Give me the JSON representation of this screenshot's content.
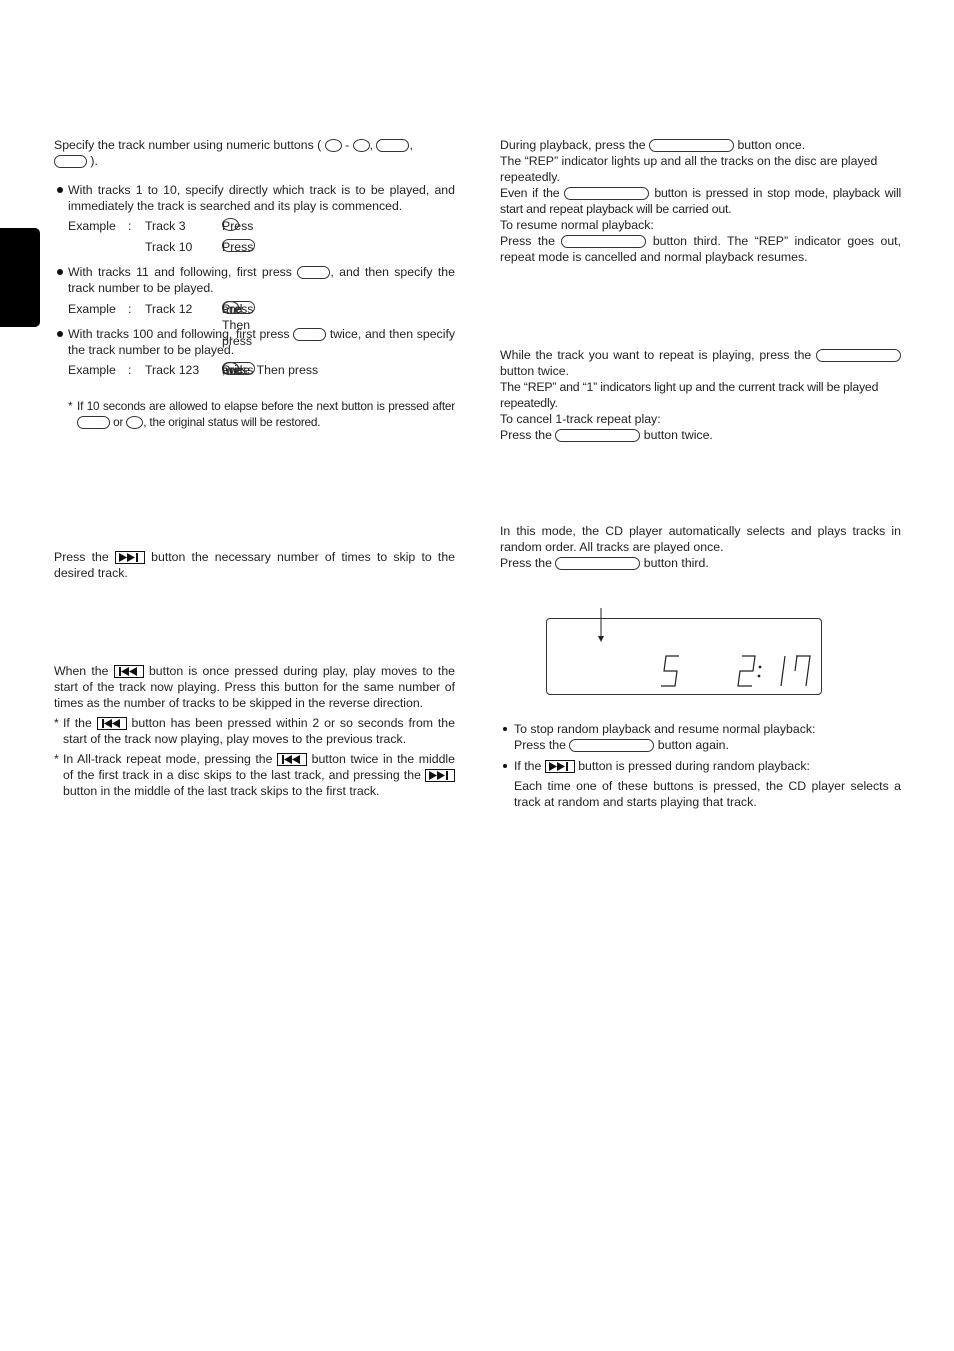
{
  "left": {
    "direct_select": {
      "intro_a": "Specify the track number using numeric buttons (",
      "intro_dash": "-",
      "intro_comma": ",",
      "intro_comma2": ",",
      "intro_end": ").",
      "bullets": [
        {
          "text": "With tracks 1 to 10, specify directly which track is to be played, and immediately the track is searched and its play is commenced.",
          "examples": [
            {
              "label": "Example",
              "colon": ":",
              "track": "Track 3",
              "press": "Press",
              "end": "."
            },
            {
              "track": "Track 10",
              "press": "Press",
              "end": "."
            }
          ]
        },
        {
          "text_a": "With tracks 11 and following, first press",
          "text_b": ", and then specify the track number to be played.",
          "example": {
            "label": "Example",
            "colon": ":",
            "track": "Track 12",
            "press": "Press",
            "then": ". Then press",
            "and": "and",
            "end": "."
          }
        },
        {
          "text_a": "With tracks 100 and following, first press",
          "text_b": "twice, and then specify the track number to be played.",
          "example": {
            "label": "Example",
            "colon": ":",
            "track": "Track 123",
            "press": "Press",
            "then": "twice.  Then press",
            "comma": ",",
            "and": "and",
            "end": "."
          }
        }
      ],
      "note": {
        "asterisk": "*",
        "text_a": "If 10 seconds are allowed to elapse before the next button is pressed after",
        "or": "or",
        "text_b": ", the original status will be restored."
      }
    },
    "skip_forward": {
      "text_a": "Press the",
      "text_b": "button the necessary number of times to skip to the desired track."
    },
    "skip_back": {
      "text_a": "When the",
      "text_b": "button is once pressed during play, play moves to the start of the track now playing.  Press this button for the same number of times as the number of tracks to be skipped in the reverse direction.",
      "notes": [
        {
          "asterisk": "*",
          "text_a": "If the",
          "text_b": "button has been pressed within 2 or so seconds from the start of the track now playing, play moves to the previous track."
        },
        {
          "asterisk": "*",
          "text_a": "In All-track repeat mode, pressing the",
          "text_b": "button twice in the middle of the first track in a disc skips to the last track, and pressing the",
          "text_c": "button in the middle of the last track skips to the first track."
        }
      ]
    }
  },
  "right": {
    "repeat_all": {
      "line1_a": "During playback, press the",
      "line1_b": "button once.",
      "line2": "The “REP” indicator lights up and all the tracks on the disc are played repeatedly.",
      "line3_a": "Even if the",
      "line3_b": "button is pressed in stop mode, playback will start and repeat playback will be carried out.",
      "line4": "To resume normal playback:",
      "line5_a": "Press the",
      "line5_b": "button third. The “REP” indicator goes out, repeat mode is cancelled and normal playback resumes."
    },
    "repeat_one": {
      "line1_a": "While the track you want to repeat is playing, press the",
      "line1_b": "button twice.",
      "line2": "The “REP” and “1” indicators light up and the current track will be played repeatedly.",
      "line3": "To cancel 1-track repeat play:",
      "line4_a": "Press the",
      "line4_b": "button twice."
    },
    "random": {
      "line1": "In this mode, the CD player automatically selects and plays tracks in random order. All tracks are played once.",
      "line2_a": "Press the",
      "line2_b": "button third.",
      "display": {
        "track": "5",
        "time": "2:17"
      },
      "bullets": [
        {
          "text": "To stop random playback and resume normal playback:",
          "sub_a": "Press the",
          "sub_b": "button again."
        },
        {
          "text_a": "If the",
          "text_b": "button is pressed during random playback:",
          "sub": "Each time one of these buttons is pressed, the CD player selects a track at random and starts playing that track."
        }
      ]
    }
  },
  "icons": {
    "next": "skip-forward-icon",
    "prev": "skip-back-icon"
  }
}
